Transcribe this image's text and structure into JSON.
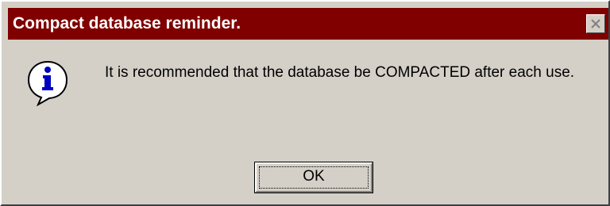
{
  "window": {
    "title": "Compact database reminder.",
    "close_icon": "close-icon",
    "title_bar_color": "#800000",
    "background_color": "#d4d0c8"
  },
  "dialog": {
    "icon": "info-icon",
    "message": "It is recommended that the database be COMPACTED after each use.",
    "ok_label": "OK"
  }
}
